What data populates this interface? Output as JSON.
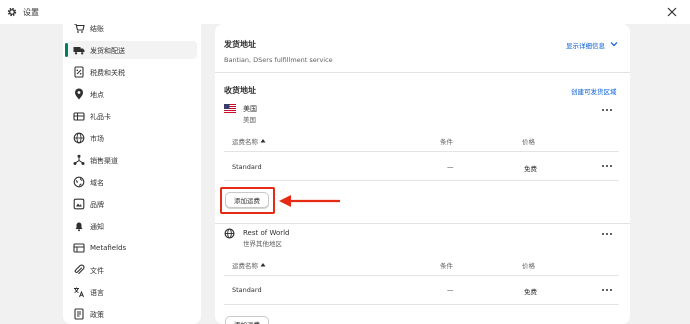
{
  "window": {
    "title": "设置"
  },
  "sidebar": {
    "items": [
      {
        "label": "结账",
        "icon": "cart-icon"
      },
      {
        "label": "发货和配送",
        "icon": "truck-icon",
        "active": true
      },
      {
        "label": "税费和关税",
        "icon": "tax-icon"
      },
      {
        "label": "地点",
        "icon": "location-pin-icon"
      },
      {
        "label": "礼品卡",
        "icon": "gift-card-icon"
      },
      {
        "label": "市场",
        "icon": "globe-icon"
      },
      {
        "label": "销售渠道",
        "icon": "channels-icon"
      },
      {
        "label": "域名",
        "icon": "domain-globe-icon"
      },
      {
        "label": "品牌",
        "icon": "brand-icon"
      },
      {
        "label": "通知",
        "icon": "bell-icon"
      },
      {
        "label": "Metafields",
        "icon": "metafields-icon"
      },
      {
        "label": "文件",
        "icon": "attachment-icon"
      },
      {
        "label": "语言",
        "icon": "translate-icon"
      },
      {
        "label": "政策",
        "icon": "policy-icon"
      }
    ]
  },
  "origin": {
    "title": "发货地址",
    "subtitle": "Bantian, DSers fulfillment service",
    "toggle_link": "显示详细信息"
  },
  "zones": {
    "title": "收货地址",
    "create_link": "创建可发货区域",
    "zone1": {
      "name": "美国",
      "subname": "美国",
      "flag": "us-flag",
      "headers": {
        "name": "运费名称",
        "condition": "条件",
        "price": "价格"
      },
      "rate": {
        "name": "Standard",
        "condition": "—",
        "price": "免费"
      },
      "add_button": "添加运费"
    },
    "zone2": {
      "name": "Rest of World",
      "subname": "世界其他地区",
      "headers": {
        "name": "运费名称",
        "condition": "条件",
        "price": "价格"
      },
      "rate": {
        "name": "Standard",
        "condition": "—",
        "price": "免费"
      },
      "add_button": "添加运费"
    }
  },
  "colors": {
    "accent": "#008060",
    "link": "#005bd3",
    "highlight": "#e52b13"
  }
}
